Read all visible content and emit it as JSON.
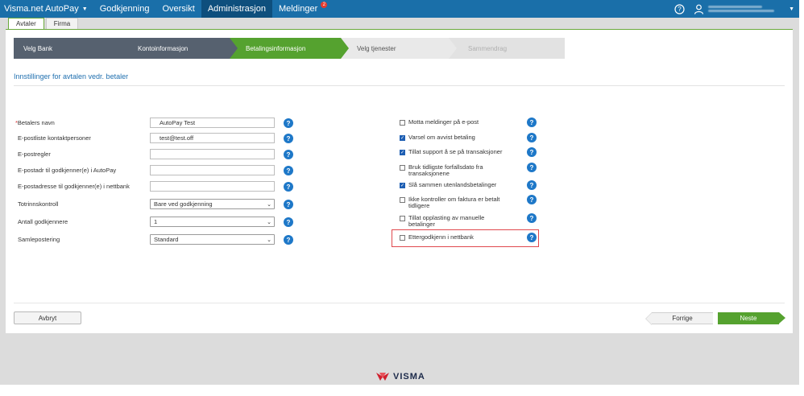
{
  "topbar": {
    "brand": "Visma.net AutoPay",
    "nav": [
      {
        "label": "Godkjenning",
        "active": false
      },
      {
        "label": "Oversikt",
        "active": false
      },
      {
        "label": "Administrasjon",
        "active": true
      },
      {
        "label": "Meldinger",
        "active": false,
        "badge": "2"
      }
    ],
    "help_glyph": "?"
  },
  "tabs": [
    {
      "label": "Avtaler",
      "active": true
    },
    {
      "label": "Firma",
      "active": false
    }
  ],
  "wizard": {
    "steps": [
      {
        "label": "Velg Bank",
        "state": "done"
      },
      {
        "label": "Kontoinformasjon",
        "state": "done"
      },
      {
        "label": "Betalingsinformasjon",
        "state": "current"
      },
      {
        "label": "Velg tjenester",
        "state": "next"
      },
      {
        "label": "Sammendrag",
        "state": "disabled"
      }
    ]
  },
  "section_title": "Innstillinger for avtalen vedr. betaler",
  "form": {
    "fields": [
      {
        "label": "Betalers navn",
        "required": true,
        "type": "text",
        "value": "AutoPay Test"
      },
      {
        "label": "E-postliste kontaktpersoner",
        "required": false,
        "type": "text",
        "value": "test@test.off"
      },
      {
        "label": "E-postregler",
        "required": false,
        "type": "text",
        "value": ""
      },
      {
        "label": "E-postadr til godkjenner(e) i AutoPay",
        "required": false,
        "type": "text",
        "value": ""
      },
      {
        "label": "E-postadresse til godkjenner(e) i nettbank",
        "required": false,
        "type": "text",
        "value": ""
      },
      {
        "label": "Totrinnskontroll",
        "required": false,
        "type": "select",
        "value": "Bare ved godkjenning"
      },
      {
        "label": "Antall godkjennere",
        "required": false,
        "type": "select",
        "value": "1"
      },
      {
        "label": "Samlepostering",
        "required": false,
        "type": "select",
        "value": "Standard"
      }
    ],
    "required_marker": "*"
  },
  "options": [
    {
      "label": "Motta meldinger på e-post",
      "checked": false
    },
    {
      "label": "Varsel om avvist betaling",
      "checked": true
    },
    {
      "label": "Tillat support å se på transaksjoner",
      "checked": true
    },
    {
      "label": "Bruk tidligste forfallsdato fra transaksjonene",
      "checked": false
    },
    {
      "label": "Slå sammen utenlandsbetalinger",
      "checked": true
    },
    {
      "label": "Ikke kontroller om faktura er betalt tidligere",
      "checked": false
    },
    {
      "label": "Tillat opplasting av manuelle betalinger",
      "checked": false
    },
    {
      "label": "Ettergodkjenn i nettbank",
      "checked": false
    }
  ],
  "buttons": {
    "cancel": "Avbryt",
    "prev": "Forrige",
    "next": "Neste"
  },
  "footer": {
    "logo_text": "VISMA"
  },
  "colors": {
    "topbar": "#1a6fa9",
    "active_nav": "#0e4f7d",
    "accent_green": "#55a22f",
    "step_done": "#56616f",
    "help_blue": "#1e78c8",
    "highlight_red": "#e0484d",
    "logo_red": "#d0202e"
  }
}
